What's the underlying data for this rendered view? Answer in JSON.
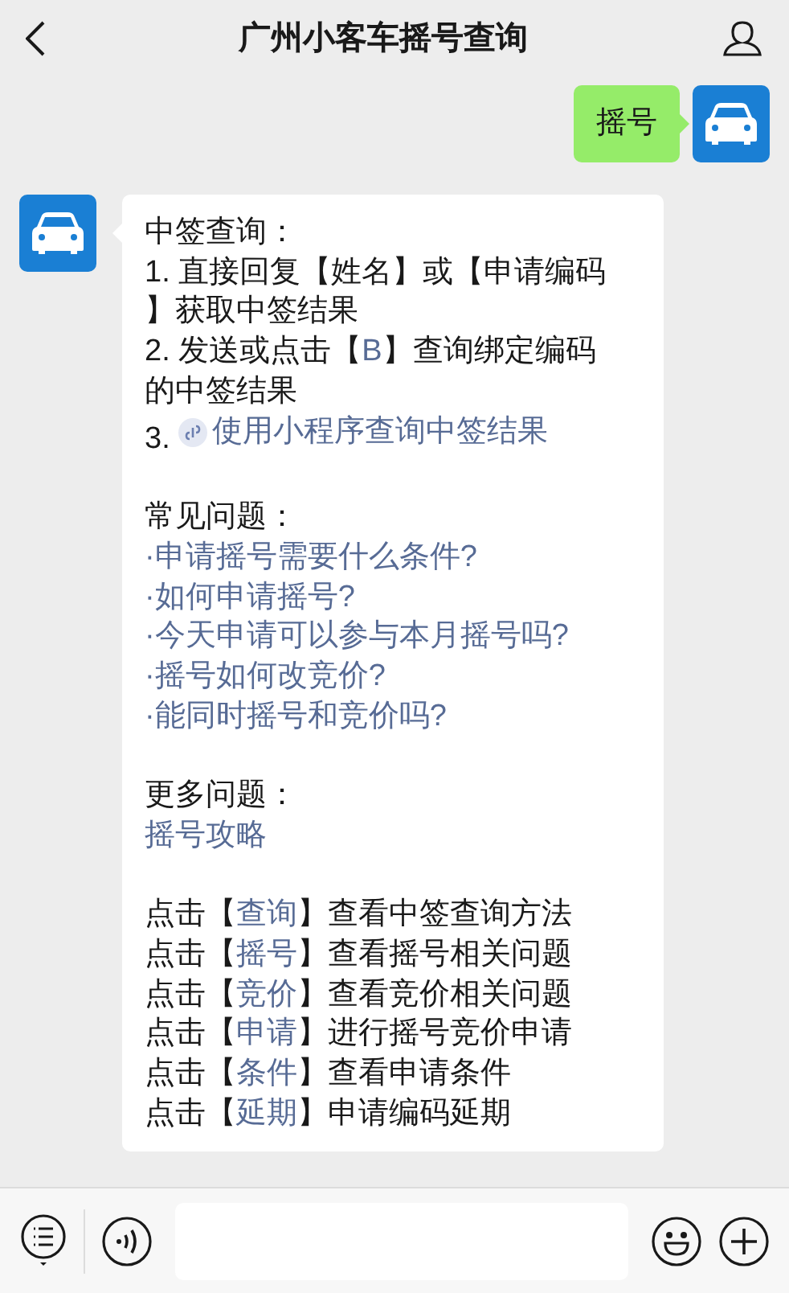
{
  "header": {
    "title": "广州小客车摇号查询"
  },
  "messages": [
    {
      "kind": "sent",
      "text": "摇号"
    },
    {
      "kind": "received",
      "sections": [
        {
          "lines": [
            {
              "parts": [
                {
                  "text": "中签查询："
                }
              ]
            },
            {
              "parts": [
                {
                  "text": "1. 直接回复【姓名】或【申请编码"
                }
              ]
            },
            {
              "parts": [
                {
                  "text": "】获取中签结果"
                }
              ]
            },
            {
              "parts": [
                {
                  "text": "2. 发送或点击【"
                },
                {
                  "text": "B",
                  "link": true
                },
                {
                  "text": "】查询绑定编码"
                }
              ]
            },
            {
              "parts": [
                {
                  "text": "的中签结果"
                }
              ]
            },
            {
              "parts": [
                {
                  "text": "3. "
                },
                {
                  "text": "使用小程序查询中签结果",
                  "link": true,
                  "kind": "miniprogram"
                }
              ]
            }
          ]
        },
        {
          "lines": [
            {
              "parts": [
                {
                  "text": "常见问题："
                }
              ]
            },
            {
              "parts": [
                {
                  "text": "·申请摇号需要什么条件?",
                  "link": true
                }
              ]
            },
            {
              "parts": [
                {
                  "text": "·如何申请摇号?",
                  "link": true
                }
              ]
            },
            {
              "parts": [
                {
                  "text": "·今天申请可以参与本月摇号吗?",
                  "link": true
                }
              ]
            },
            {
              "parts": [
                {
                  "text": "·摇号如何改竞价?",
                  "link": true
                }
              ]
            },
            {
              "parts": [
                {
                  "text": "·能同时摇号和竞价吗?",
                  "link": true
                }
              ]
            }
          ]
        },
        {
          "lines": [
            {
              "parts": [
                {
                  "text": "更多问题："
                }
              ]
            },
            {
              "parts": [
                {
                  "text": "摇号攻略",
                  "link": true
                }
              ]
            }
          ]
        },
        {
          "lines": [
            {
              "parts": [
                {
                  "text": "点击【"
                },
                {
                  "text": "查询",
                  "link": true
                },
                {
                  "text": "】查看中签查询方法"
                }
              ]
            },
            {
              "parts": [
                {
                  "text": "点击【"
                },
                {
                  "text": "摇号",
                  "link": true
                },
                {
                  "text": "】查看摇号相关问题"
                }
              ]
            },
            {
              "parts": [
                {
                  "text": "点击【"
                },
                {
                  "text": "竞价",
                  "link": true
                },
                {
                  "text": "】查看竞价相关问题"
                }
              ]
            },
            {
              "parts": [
                {
                  "text": "点击【"
                },
                {
                  "text": "申请",
                  "link": true
                },
                {
                  "text": "】进行摇号竞价申请"
                }
              ]
            },
            {
              "parts": [
                {
                  "text": "点击【"
                },
                {
                  "text": "条件",
                  "link": true
                },
                {
                  "text": "】查看申请条件"
                }
              ]
            },
            {
              "parts": [
                {
                  "text": "点击【"
                },
                {
                  "text": "延期",
                  "link": true
                },
                {
                  "text": "】申请编码延期"
                }
              ]
            }
          ]
        }
      ]
    }
  ]
}
